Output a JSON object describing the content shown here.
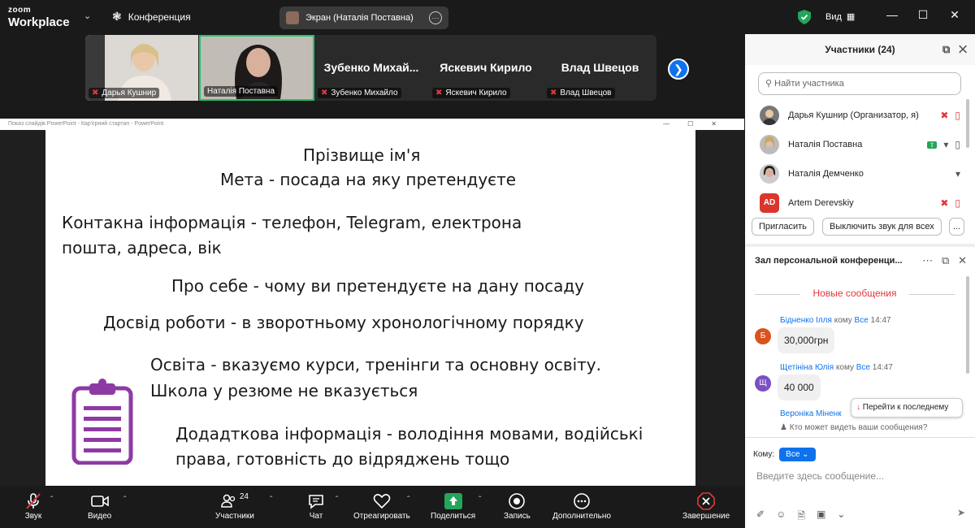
{
  "titlebar": {
    "logo_line1": "zoom",
    "logo_line2": "Workplace",
    "conference_label": "Конференция",
    "screen_share_label": "Экран (Наталія Поставна)",
    "view_label": "Вид",
    "colors": {
      "security_shield": "#23a55a"
    }
  },
  "video_strip": {
    "tiles": [
      {
        "name": "Дарья Кушнир",
        "muted": true
      },
      {
        "name": "Наталія Поставна",
        "muted": false,
        "active_speaker": true
      },
      {
        "display": "Зубенко Михай...",
        "name": "Зубенко Михайло",
        "muted": true
      },
      {
        "display": "Яскевич Кирило",
        "name": "Яскевич Кирило",
        "muted": true
      },
      {
        "display": "Влад Швецов",
        "name": "Влад Швецов",
        "muted": true
      }
    ]
  },
  "shared_screen": {
    "window_title": "Показ слайдів PowerPoint  -  Кар'єрний стартап - PowerPoint",
    "slide_lines": [
      "Прізвище ім'я",
      "Мета - посада на яку претендуєте",
      "Контакна інформація - телефон, Telegram, електрона",
      "пошта, адреса, вік",
      "Про себе - чому ви претендуєте на дану посаду",
      "Досвід роботи - в зворотньому хронологічному порядку",
      "Освіта - вказуємо курси, тренінги та основну освіту.",
      "Школа у резюме не вказується",
      "Додадткова інформація - володіння мовами, водійські",
      "права, готовність до відряджень тощо"
    ]
  },
  "toolbar": {
    "audio": "Звук",
    "video": "Видео",
    "participants": "Участники",
    "participants_count": "24",
    "chat": "Чат",
    "react": "Отреагировать",
    "share": "Поделиться",
    "record": "Запись",
    "more": "Дополнительно",
    "end": "Завершение",
    "colors": {
      "share_green": "#23a55a",
      "end_red": "#e0383e"
    }
  },
  "participants_panel": {
    "title": "Участники (24)",
    "search_placeholder": "Найти участника",
    "participants": [
      {
        "name": "Дарья Кушнир (Организатор, я)",
        "mic": "muted",
        "video": "off"
      },
      {
        "name": "Наталія Поставна",
        "mic": "on",
        "video": "off",
        "sharing": true
      },
      {
        "name": "Наталія Демченко",
        "mic": "on"
      },
      {
        "name": "Artem Derevskiy",
        "initials": "AD",
        "mic": "muted",
        "video": "off"
      }
    ],
    "invite_label": "Пригласить",
    "mute_all_label": "Выключить звук для всех",
    "more_label": "..."
  },
  "chat_panel": {
    "title": "Зал персональной конференци...",
    "new_messages_label": "Новые сообщения",
    "messages": [
      {
        "avatar_letter": "Б",
        "avatar_color": "#d9531e",
        "sender": "Бідненко Ілля",
        "to_word": "кому",
        "recipient": "Все",
        "time": "14:47",
        "text": "30,000грн"
      },
      {
        "avatar_letter": "Щ",
        "avatar_color": "#7b4fc4",
        "sender": "Щетініна Юлія",
        "to_word": "кому",
        "recipient": "Все",
        "time": "14:47",
        "text": "40 000"
      },
      {
        "sender": "Вероніка Міненко",
        "partial": "Вероніка Міненк"
      }
    ],
    "jump_to_latest": "Перейти к последнему",
    "who_can_see": "Кто может видеть ваши сообщения?",
    "to_label": "Кому:",
    "to_value": "Все",
    "input_placeholder": "Введите здесь сообщение..."
  }
}
